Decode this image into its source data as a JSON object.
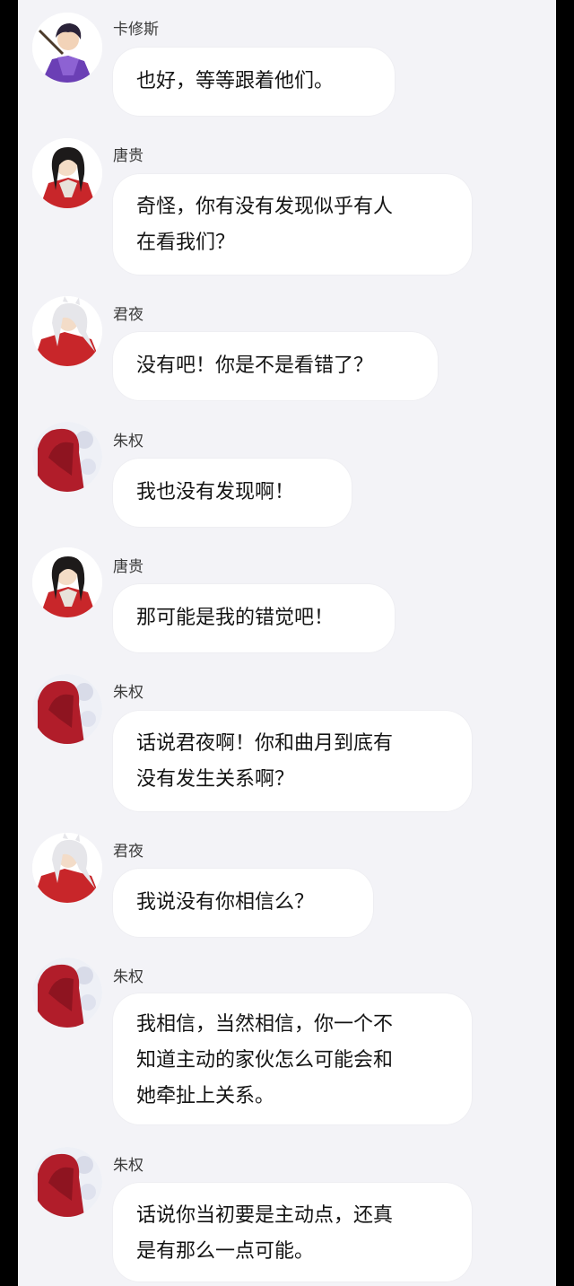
{
  "messages": [
    {
      "sender": "卡修斯",
      "avatar": "purple-ninja-avatar-icon",
      "lines": [
        "也好，等等跟着他们。"
      ]
    },
    {
      "sender": "唐贵",
      "avatar": "red-robe-long-hair-avatar-icon",
      "lines": [
        "奇怪，你有没有发现似乎有人",
        "在看我们？"
      ]
    },
    {
      "sender": "君夜",
      "avatar": "white-hair-red-robe-avatar-icon",
      "lines": [
        "没有吧！你是不是看错了？"
      ]
    },
    {
      "sender": "朱权",
      "avatar": "red-hair-avatar-icon",
      "lines": [
        "我也没有发现啊！"
      ]
    },
    {
      "sender": "唐贵",
      "avatar": "red-robe-long-hair-avatar-icon",
      "lines": [
        "那可能是我的错觉吧！"
      ]
    },
    {
      "sender": "朱权",
      "avatar": "red-hair-avatar-icon",
      "lines": [
        "话说君夜啊！你和曲月到底有",
        "没有发生关系啊？"
      ]
    },
    {
      "sender": "君夜",
      "avatar": "white-hair-red-robe-avatar-icon",
      "lines": [
        "我说没有你相信么？"
      ]
    },
    {
      "sender": "朱权",
      "avatar": "red-hair-avatar-icon",
      "lines": [
        "我相信，当然相信，你一个不",
        "知道主动的家伙怎么可能会和",
        "她牵扯上关系。"
      ]
    },
    {
      "sender": "朱权",
      "avatar": "red-hair-avatar-icon",
      "lines": [
        "话说你当初要是主动点，还真",
        "是有那么一点可能。"
      ]
    }
  ]
}
